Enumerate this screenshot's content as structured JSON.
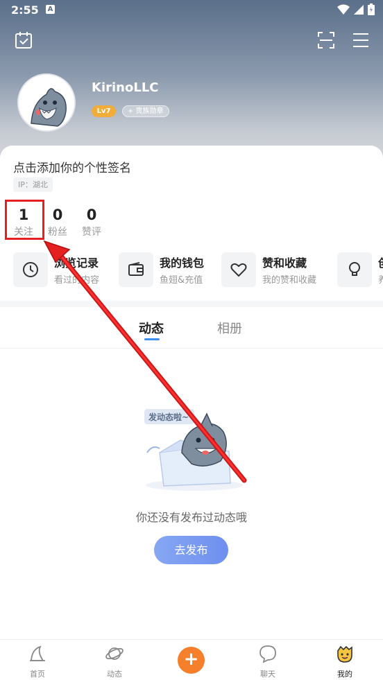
{
  "status_bar": {
    "time": "2:55",
    "notification_glyph": "A"
  },
  "header": {
    "username": "KirinoLLC",
    "level": "Lv7",
    "medal": "+ 贵族勋章"
  },
  "profile": {
    "signature": "点击添加你的个性签名",
    "ip": "IP：湖北"
  },
  "stats": [
    {
      "value": "1",
      "label": "关注"
    },
    {
      "value": "0",
      "label": "粉丝"
    },
    {
      "value": "0",
      "label": "赞评"
    }
  ],
  "quick_entries": [
    {
      "title": "浏览记录",
      "subtitle": "看过的内容",
      "icon": "clock-icon"
    },
    {
      "title": "我的钱包",
      "subtitle": "鱼翅&充值",
      "icon": "wallet-icon"
    },
    {
      "title": "赞和收藏",
      "subtitle": "我的赞和收藏",
      "icon": "heart-icon"
    },
    {
      "title": "创",
      "subtitle": "养",
      "icon": "bulb-icon"
    }
  ],
  "tabs": [
    {
      "label": "动态",
      "active": true
    },
    {
      "label": "相册",
      "active": false
    }
  ],
  "empty_state": {
    "bubble": "发动态啦~",
    "message": "你还没有发布过动态哦",
    "button": "去发布"
  },
  "bottom_nav": [
    {
      "label": "首页",
      "icon": "home-icon"
    },
    {
      "label": "动态",
      "icon": "planet-icon"
    },
    {
      "label": "聊天",
      "icon": "chat-icon"
    },
    {
      "label": "我的",
      "icon": "mine-icon"
    }
  ],
  "colors": {
    "accent_blue": "#3b8ff0",
    "add_button": "#f57f2a",
    "highlight_red": "#e52020",
    "level_gold": "#f0ad3a"
  }
}
